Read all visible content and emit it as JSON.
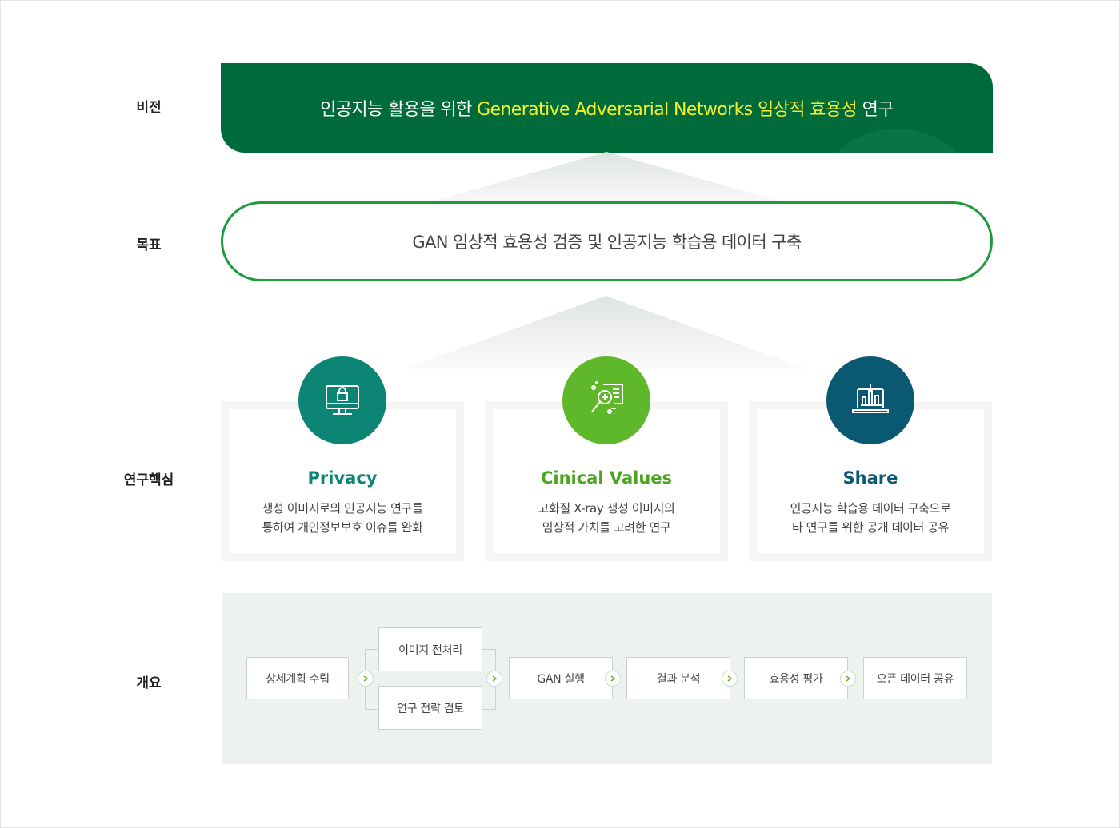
{
  "labels": {
    "vision": "비전",
    "goal": "목표",
    "core": "연구핵심",
    "overview": "개요"
  },
  "vision": {
    "prefix": "인공지능 활용을 위한 ",
    "highlight": "Generative Adversarial Networks 임상적 효용성",
    "suffix": " 연구"
  },
  "goal": "GAN 임상적 효용성 검증 및 인공지능 학습용 데이터 구축",
  "cards": [
    {
      "title": "Privacy",
      "line1": "생성 이미지로의 인공지능 연구를",
      "line2": "통하여 개인정보보호 이슈를 완화",
      "icon": "monitor-lock-icon",
      "color": "#0d8574"
    },
    {
      "title": "Cinical Values",
      "line1": "고화질 X-ray 생성 이미지의",
      "line2": "임상적 가치를 고려한 연구",
      "icon": "magnifier-document-icon",
      "color": "#5fb82a"
    },
    {
      "title": "Share",
      "line1": "인공지능 학습용 데이터 구축으로",
      "line2": "타 연구를 위한 공개 데이터 공유",
      "icon": "laptop-chart-icon",
      "color": "#0b5872"
    }
  ],
  "overview": {
    "steps": [
      "상세계획 수립",
      "이미지 전처리",
      "연구 전략 검토",
      "GAN 실행",
      "결과 분석",
      "효용성 평가",
      "오픈 데이터 공유"
    ]
  },
  "colors": {
    "vision_bg": "#006b3a",
    "highlight": "#f6ef2e",
    "goal_border": "#1d9b3b",
    "arrow": "#5fb82a"
  }
}
